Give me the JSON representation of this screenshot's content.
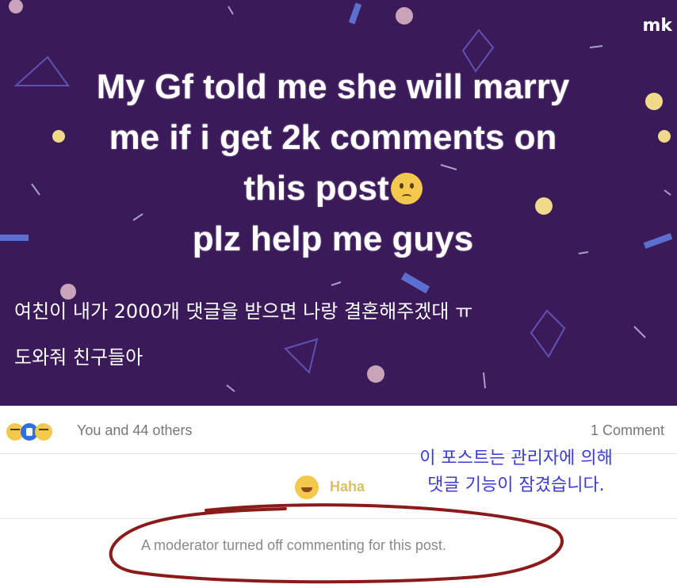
{
  "watermark": "mk",
  "post": {
    "headline_lines": [
      "My Gf told me she will marry",
      "me if i get 2k comments on",
      "this post",
      "plz help me guys"
    ],
    "emoji": "worried-face-icon",
    "korean_caption": [
      "여친이 내가 2000개 댓글을 받으면 나랑 결혼해주겠대 ㅠ",
      "도와줘 친구들아"
    ]
  },
  "reactions": {
    "icons": [
      "haha-icon",
      "like-icon",
      "sad-icon"
    ],
    "summary": "You and 44 others",
    "comment_count": "1 Comment"
  },
  "reaction_row": {
    "label": "Haha"
  },
  "lock_note": [
    "이 포스트는 관리자에 의해",
    "댓글 기능이 잠겼습니다."
  ],
  "moderator_note": "A moderator turned off commenting for this post.",
  "colors": {
    "background": "#3b1a5a",
    "lock_note": "#3b3bd6",
    "circle": "#8b1a1a"
  }
}
